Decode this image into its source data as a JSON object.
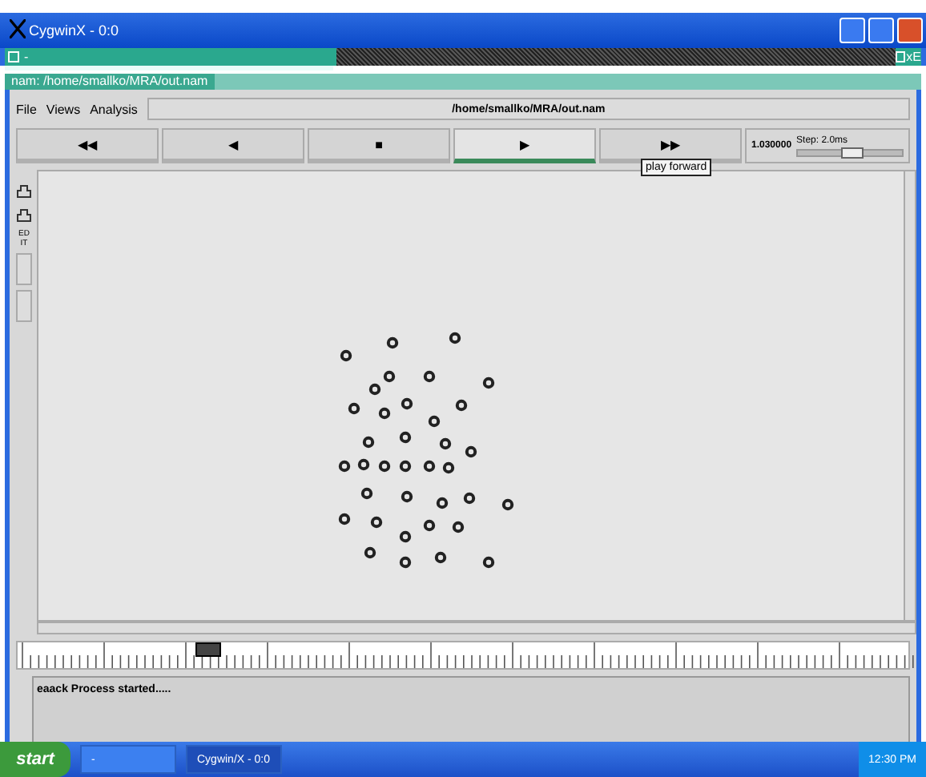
{
  "window": {
    "title": "CygwinX - 0:0"
  },
  "top_bar": {
    "left_label": "-",
    "right_label": "xE"
  },
  "nam_bar": {
    "title": "nam: /home/smallko/MRA/out.nam"
  },
  "menu": [
    {
      "label": "File"
    },
    {
      "label": "Views"
    },
    {
      "label": "Analysis"
    }
  ],
  "file_path": "/home/smallko/MRA/out.nam",
  "controls": [
    {
      "label": "◀◀",
      "selected": false
    },
    {
      "label": "◀",
      "selected": false
    },
    {
      "label": "■",
      "selected": false
    },
    {
      "label": "▶",
      "selected": true
    },
    {
      "label": "▶▶",
      "selected": false
    }
  ],
  "tooltip": "play forward",
  "time": "1.030000",
  "step": {
    "label": "Step: 2.0ms",
    "level": 0.5
  },
  "tools": [
    {
      "kind": "icon"
    },
    {
      "kind": "icon"
    },
    {
      "kind": "text",
      "label": "EDIT"
    },
    {
      "kind": "button"
    },
    {
      "kind": "button"
    }
  ],
  "timeline": {
    "level": 0.2
  },
  "log": "eaack Process started.....",
  "taskbar": {
    "start": "start",
    "items": [
      {
        "label": "-",
        "selected": false
      },
      {
        "label": "Cygwin/X - 0:0",
        "selected": true
      }
    ],
    "clock": "12:30 PM"
  }
}
